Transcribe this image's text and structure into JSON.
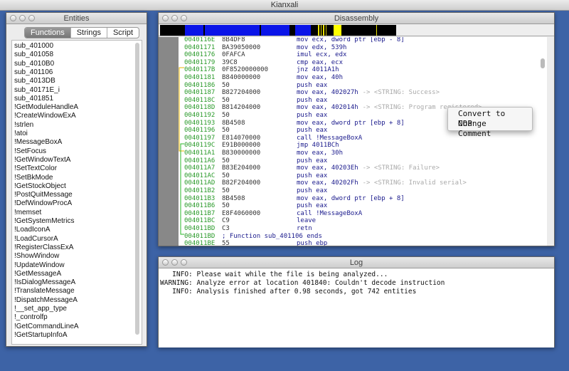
{
  "app": {
    "title": "Kianxali"
  },
  "entities": {
    "title": "Entities",
    "tabs": [
      {
        "label": "Functions",
        "active": true
      },
      {
        "label": "Strings"
      },
      {
        "label": "Script"
      }
    ],
    "items": [
      "sub_401000",
      "sub_401058",
      "sub_4010B0",
      "sub_401106",
      "sub_4013DB",
      "sub_40171E_i",
      "sub_401851",
      "!GetModuleHandleA",
      "!CreateWindowExA",
      "!strlen",
      "!atoi",
      "!MessageBoxA",
      "!SetFocus",
      "!GetWindowTextA",
      "!SetTextColor",
      "!SetBkMode",
      "!GetStockObject",
      "!PostQuitMessage",
      "!DefWindowProcA",
      "!memset",
      "!GetSystemMetrics",
      "!LoadIconA",
      "!LoadCursorA",
      "!RegisterClassExA",
      "!ShowWindow",
      "!UpdateWindow",
      "!GetMessageA",
      "!IsDialogMessageA",
      "!TranslateMessage",
      "!DispatchMessageA",
      "!__set_app_type",
      "!_controlfp",
      "!GetCommandLineA",
      "!GetStartupInfoA"
    ]
  },
  "disassembly": {
    "title": "Disassembly",
    "colors": {
      "address": "#2a9a2a",
      "instruction": "#1a1a8c",
      "comment": "#aaaaaa",
      "jump_taken": "#e8b400",
      "jump_other": "#2ab82a"
    },
    "rows": [
      [
        "0040116E",
        "8B4DF8",
        "mov ecx, dword ptr [ebp - 8]",
        ""
      ],
      [
        "00401171",
        "BA39050000",
        "mov edx, 539h",
        ""
      ],
      [
        "00401176",
        "0FAFCA",
        "imul ecx, edx",
        ""
      ],
      [
        "00401179",
        "39C8",
        "cmp eax, ecx",
        ""
      ],
      [
        "0040117B",
        "0F8520000000",
        "jnz 4011A1h",
        ""
      ],
      [
        "00401181",
        "B840000000",
        "mov eax, 40h",
        ""
      ],
      [
        "00401186",
        "50",
        "push eax",
        ""
      ],
      [
        "00401187",
        "B827204000",
        "mov eax, 402027h",
        "-> <STRING: Success>"
      ],
      [
        "0040118C",
        "50",
        "push eax",
        ""
      ],
      [
        "0040118D",
        "B814204000",
        "mov eax, 402014h",
        "-> <STRING: Program registered>"
      ],
      [
        "00401192",
        "50",
        "push eax",
        ""
      ],
      [
        "00401193",
        "8B4508",
        "mov eax, dword ptr [ebp + 8]",
        ""
      ],
      [
        "00401196",
        "50",
        "push eax",
        ""
      ],
      [
        "00401197",
        "E814070000",
        "call !MessageBoxA",
        ""
      ],
      [
        "0040119C",
        "E91B000000",
        "jmp 4011BCh",
        ""
      ],
      [
        "004011A1",
        "B830000000",
        "mov eax, 30h",
        ""
      ],
      [
        "004011A6",
        "50",
        "push eax",
        ""
      ],
      [
        "004011A7",
        "B83E204000",
        "mov eax, 40203Eh",
        "-> <STRING: Failure>"
      ],
      [
        "004011AC",
        "50",
        "push eax",
        ""
      ],
      [
        "004011AD",
        "B82F204000",
        "mov eax, 40202Fh",
        "-> <STRING: Invalid serial>"
      ],
      [
        "004011B2",
        "50",
        "push eax",
        ""
      ],
      [
        "004011B3",
        "8B4508",
        "mov eax, dword ptr [ebp + 8]",
        ""
      ],
      [
        "004011B6",
        "50",
        "push eax",
        ""
      ],
      [
        "004011B7",
        "E8F4060000",
        "call !MessageBoxA",
        ""
      ],
      [
        "004011BC",
        "C9",
        "leave",
        ""
      ],
      [
        "004011BD",
        "C3",
        "retn",
        ""
      ],
      [
        "004011BD",
        "; Function sub_401106 ends",
        "",
        ""
      ],
      [
        "004011BE",
        "55",
        "push ebp",
        ""
      ]
    ],
    "context_menu": [
      "Convert to NOP",
      "Change Comment"
    ]
  },
  "log": {
    "title": "Log",
    "lines": [
      "   INFO: Please wait while the file is being analyzed...",
      "WARNING: Analyze error at location 401840: Couldn't decode instruction",
      "   INFO: Analysis finished after 0.98 seconds, got 742 entities"
    ]
  }
}
